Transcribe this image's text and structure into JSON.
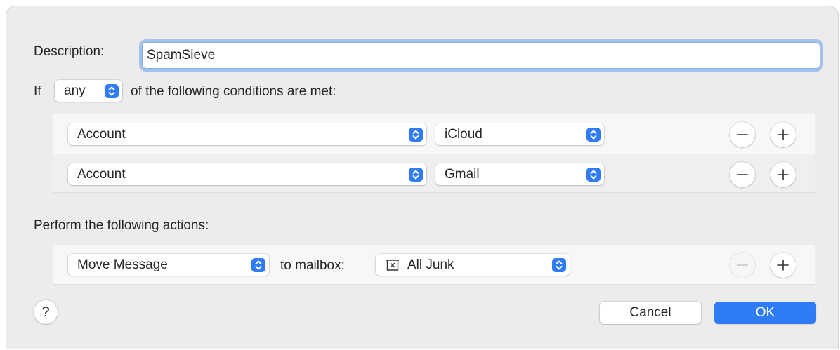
{
  "description": {
    "label": "Description:",
    "value": "SpamSieve"
  },
  "condition_header": {
    "prefix": "If",
    "match": "any",
    "suffix": "of the following conditions are met:"
  },
  "conditions": [
    {
      "field": "Account",
      "value": "iCloud"
    },
    {
      "field": "Account",
      "value": "Gmail"
    }
  ],
  "actions_header": "Perform the following actions:",
  "actions": [
    {
      "action": "Move Message",
      "connector": "to mailbox:",
      "mailbox": "All Junk",
      "mailbox_icon": "junk-tray-icon"
    }
  ],
  "buttons": {
    "help": "?",
    "cancel": "Cancel",
    "ok": "OK",
    "remove": "−",
    "add": "+"
  },
  "colors": {
    "accent": "#2f7cf6",
    "focus_ring": "#a3c1ee",
    "background": "#ececec"
  }
}
